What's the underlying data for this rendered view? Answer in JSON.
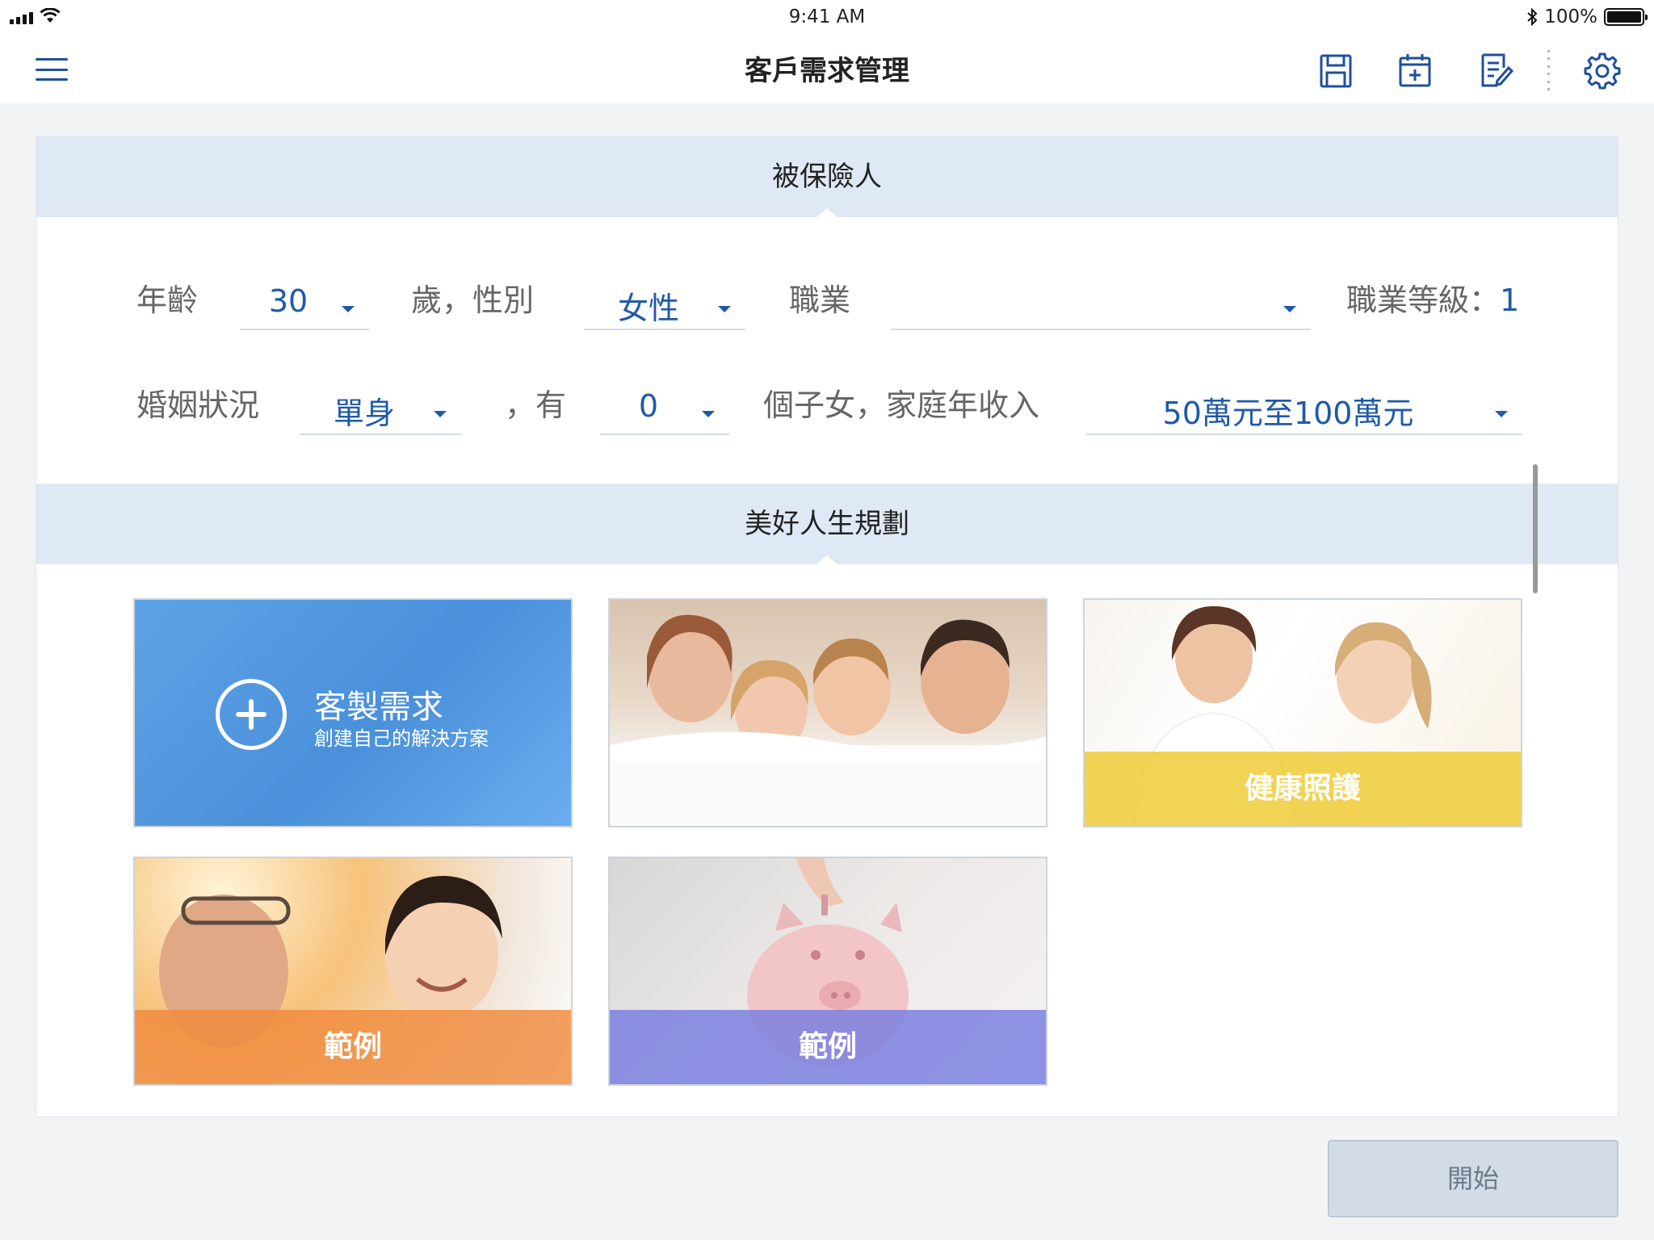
{
  "status_bar": {
    "time": "9:41 AM",
    "battery_text": "100%",
    "battery_level": 1.0
  },
  "nav": {
    "title": "客戶需求管理",
    "icons": [
      "menu-icon",
      "save-icon",
      "calendar-add-icon",
      "edit-document-icon",
      "settings-icon"
    ],
    "accent_color": "#1f4f9d"
  },
  "insured_section": {
    "header": "被保險人",
    "age_label": "年齡",
    "age_value": "30",
    "age_suffix": "歲，性別",
    "gender_value": "女性",
    "occupation_label": "職業",
    "occupation_value": "",
    "occupation_level_label": "職業等級：",
    "occupation_level_value": "1",
    "marital_label": "婚姻狀況",
    "marital_value": "單身",
    "children_prefix": "，有",
    "children_value": "0",
    "children_suffix": "個子女，家庭年收入",
    "income_value": "50萬元至100萬元"
  },
  "planning_section": {
    "header": "美好人生規劃",
    "tiles": [
      {
        "title": "客製需求",
        "subtitle": "創建自己的解決方案",
        "color": "#4a90da"
      },
      {
        "label": "",
        "image": "family-in-bed-photo"
      },
      {
        "label": "健康照護",
        "color": "#f0d040",
        "image": "doctor-and-child-photo"
      },
      {
        "label": "範例",
        "color": "#f08a3c",
        "image": "grandparent-and-child-photo"
      },
      {
        "label": "範例",
        "color": "#7b7fe0",
        "image": "piggy-bank-photo"
      }
    ]
  },
  "actions": {
    "start_label": "開始"
  }
}
